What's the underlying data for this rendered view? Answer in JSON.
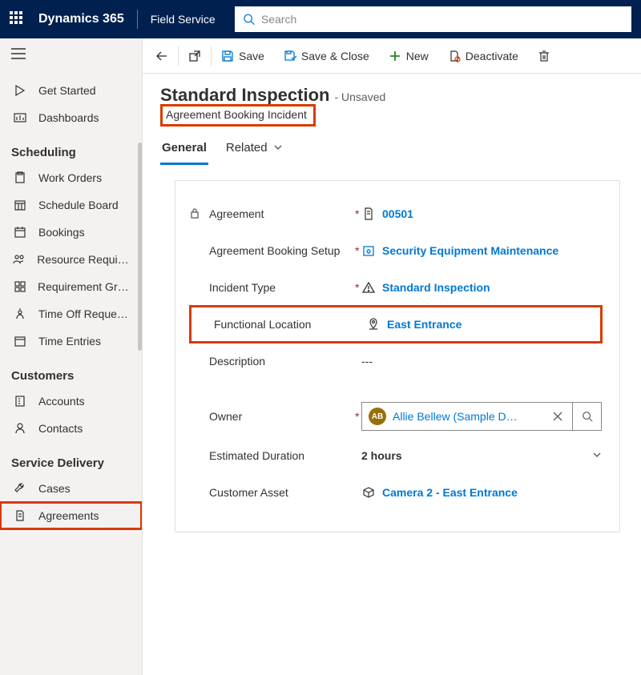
{
  "header": {
    "brand": "Dynamics 365",
    "app": "Field Service",
    "search_placeholder": "Search"
  },
  "sidebar": {
    "collapsed_item": "",
    "items_top": [
      {
        "label": "Get Started"
      },
      {
        "label": "Dashboards"
      }
    ],
    "section_scheduling": "Scheduling",
    "scheduling_items": [
      {
        "label": "Work Orders"
      },
      {
        "label": "Schedule Board"
      },
      {
        "label": "Bookings"
      },
      {
        "label": "Resource Require…"
      },
      {
        "label": "Requirement Gro…"
      },
      {
        "label": "Time Off Requests"
      },
      {
        "label": "Time Entries"
      }
    ],
    "section_customers": "Customers",
    "customers_items": [
      {
        "label": "Accounts"
      },
      {
        "label": "Contacts"
      }
    ],
    "section_service": "Service Delivery",
    "service_items": [
      {
        "label": "Cases"
      },
      {
        "label": "Agreements"
      }
    ]
  },
  "commands": {
    "save": "Save",
    "save_close": "Save & Close",
    "new": "New",
    "deactivate": "Deactivate"
  },
  "page": {
    "title": "Standard Inspection",
    "unsaved": "- Unsaved",
    "subtitle": "Agreement Booking Incident",
    "tabs": {
      "general": "General",
      "related": "Related"
    }
  },
  "form": {
    "agreement": {
      "label": "Agreement",
      "value": "00501"
    },
    "booking_setup": {
      "label": "Agreement Booking Setup",
      "value": "Security Equipment Maintenance"
    },
    "incident_type": {
      "label": "Incident Type",
      "value": "Standard Inspection"
    },
    "functional_location": {
      "label": "Functional Location",
      "value": "East Entrance"
    },
    "description": {
      "label": "Description",
      "value": "---"
    },
    "owner": {
      "label": "Owner",
      "initials": "AB",
      "value": "Allie Bellew (Sample D…"
    },
    "estimated_duration": {
      "label": "Estimated Duration",
      "value": "2 hours"
    },
    "customer_asset": {
      "label": "Customer Asset",
      "value": "Camera 2 - East Entrance"
    }
  }
}
